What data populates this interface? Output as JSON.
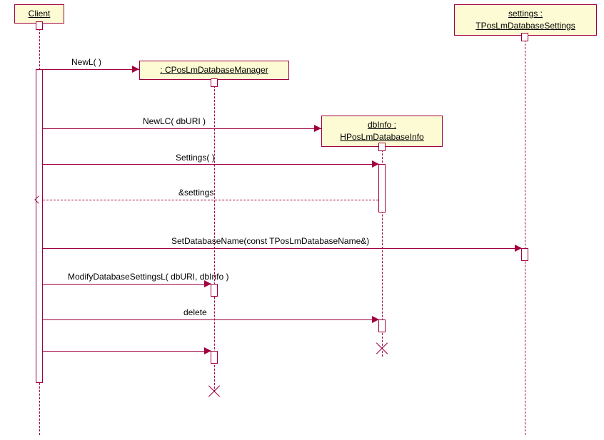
{
  "participants": {
    "client": {
      "label": "Client"
    },
    "manager": {
      "label": ": CPosLmDatabaseManager"
    },
    "dbinfo": {
      "line1": "dbInfo :",
      "line2": "HPosLmDatabaseInfo"
    },
    "settings": {
      "line1": "settings :",
      "line2": "TPosLmDatabaseSettings"
    }
  },
  "messages": {
    "m1": "NewL( )",
    "m2": "NewLC( dbURI )",
    "m3": "Settings( )",
    "r3": "&settings",
    "m4": "SetDatabaseName(const TPosLmDatabaseName&)",
    "m5": "ModifyDatabaseSettingsL( dbURI, dbInfo )",
    "m6": "delete"
  }
}
